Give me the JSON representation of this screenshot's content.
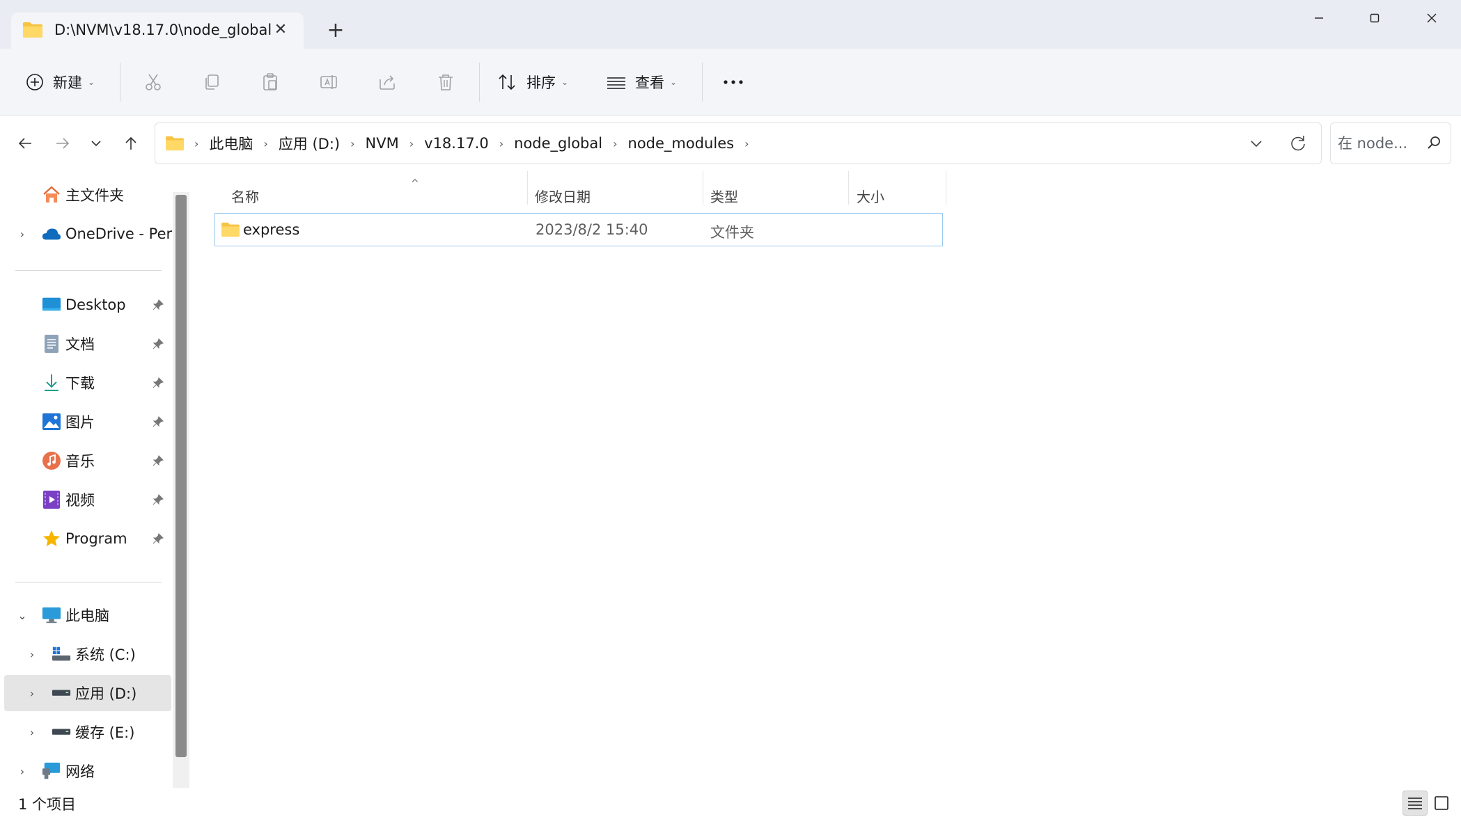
{
  "tab": {
    "title": "D:\\NVM\\v18.17.0\\node_global",
    "close_symbol": "✕",
    "new_tab_symbol": "+"
  },
  "window_controls": {
    "minimize_symbol": "—",
    "maximize_symbol": "☐",
    "close_symbol": "✕"
  },
  "toolbar": {
    "new_label": "新建",
    "sort_label": "排序",
    "view_label": "查看",
    "more_symbol": "•••",
    "caret_symbol": "⌄"
  },
  "address": {
    "breadcrumbs": [
      "此电脑",
      "应用 (D:)",
      "NVM",
      "v18.17.0",
      "node_global",
      "node_modules"
    ],
    "separator": "›",
    "search_placeholder": "在 node..."
  },
  "sidebar": {
    "home": "主文件夹",
    "onedrive": "OneDrive - Per",
    "quick_access": [
      {
        "label": "Desktop",
        "icon": "desktop-icon"
      },
      {
        "label": "文档",
        "icon": "documents-icon"
      },
      {
        "label": "下载",
        "icon": "downloads-icon"
      },
      {
        "label": "图片",
        "icon": "pictures-icon"
      },
      {
        "label": "音乐",
        "icon": "music-icon"
      },
      {
        "label": "视频",
        "icon": "videos-icon"
      },
      {
        "label": "Program",
        "icon": "star-icon"
      }
    ],
    "this_pc": "此电脑",
    "drives": [
      {
        "label": "系统 (C:)",
        "icon": "windows-drive-icon"
      },
      {
        "label": "应用 (D:)",
        "icon": "drive-icon",
        "selected": true
      },
      {
        "label": "缓存 (E:)",
        "icon": "drive-icon"
      }
    ],
    "network": "网络",
    "chevron_right": "›",
    "chevron_down": "⌄"
  },
  "columns": {
    "name": "名称",
    "modified": "修改日期",
    "type": "类型",
    "size": "大小",
    "sort_indicator": "^"
  },
  "files": [
    {
      "name": "express",
      "modified": "2023/8/2 15:40",
      "type": "文件夹",
      "size": ""
    }
  ],
  "status": {
    "item_count": "1 个项目"
  },
  "colors": {
    "titlebar_bg": "#e9ecf2",
    "toolbar_bg": "#f3f5f9",
    "folder_yellow": "#f6c343",
    "selection_border": "#99c9ef"
  }
}
